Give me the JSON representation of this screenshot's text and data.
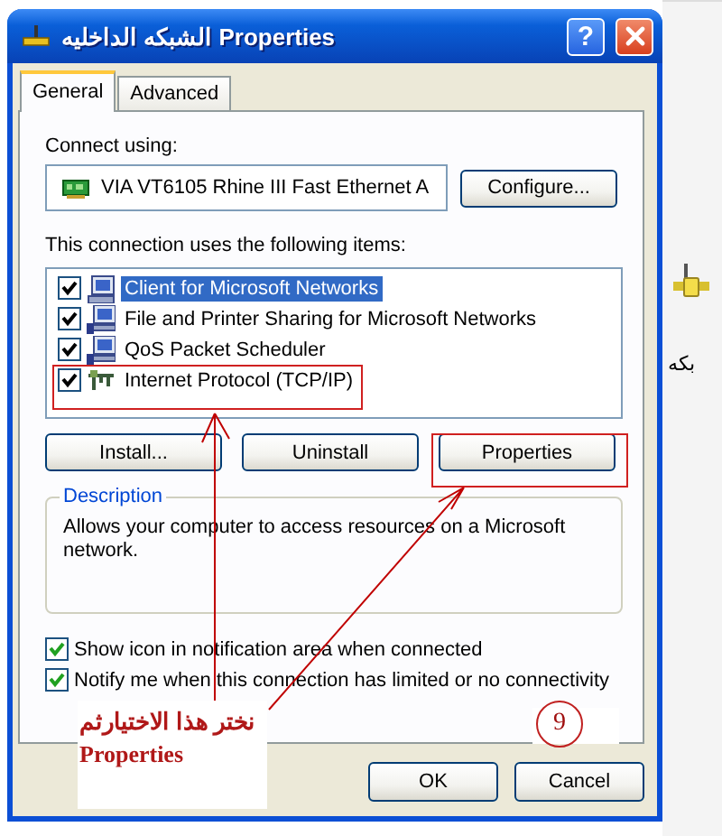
{
  "window": {
    "title": "الشبكه الداخليه Properties",
    "help_button": "?"
  },
  "tabs": [
    {
      "label": "General",
      "selected": true
    },
    {
      "label": "Advanced",
      "selected": false
    }
  ],
  "connect_using": {
    "label": "Connect using:",
    "adapter": "VIA VT6105 Rhine III Fast Ethernet A",
    "configure_button": "Configure..."
  },
  "items_label": "This connection uses the following items:",
  "items": [
    {
      "label": "Client for Microsoft Networks",
      "checked": true,
      "selected": true,
      "kind": "client"
    },
    {
      "label": "File and Printer Sharing for Microsoft Networks",
      "checked": true,
      "selected": false,
      "kind": "service"
    },
    {
      "label": "QoS Packet Scheduler",
      "checked": true,
      "selected": false,
      "kind": "service"
    },
    {
      "label": "Internet Protocol (TCP/IP)",
      "checked": true,
      "selected": false,
      "kind": "protocol"
    }
  ],
  "item_buttons": [
    "Install...",
    "Uninstall",
    "Properties"
  ],
  "description": {
    "title": "Description",
    "text": "Allows your computer to access resources on a Microsoft network."
  },
  "options": [
    {
      "label": "Show icon in notification area when connected",
      "checked": true
    },
    {
      "label": "Notify me when this connection has limited or no connectivity",
      "checked": true
    }
  ],
  "dialog_buttons": [
    "OK",
    "Cancel"
  ],
  "annotation": {
    "note_lines": [
      "نختر هذا الاختيارثم",
      "Properties"
    ],
    "step": "9"
  },
  "background": {
    "partial_text": "بكه"
  }
}
